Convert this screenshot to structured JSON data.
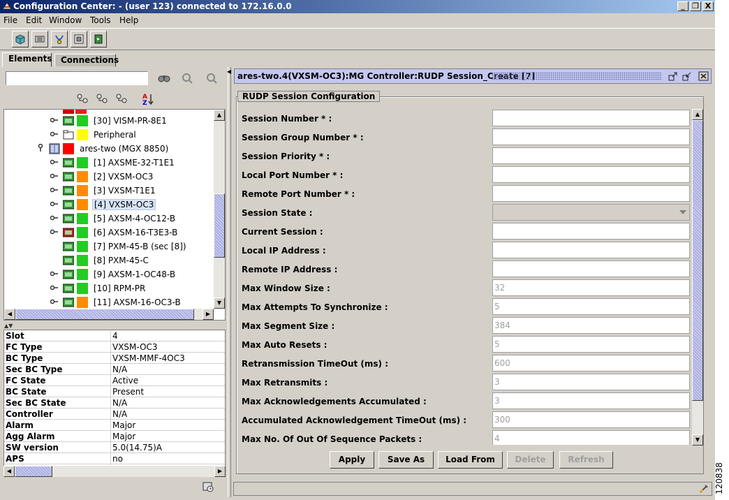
{
  "window": {
    "title": "Configuration Center: - (user 123) connected to 172.16.0.0",
    "buttons": [
      "_",
      "ͦ",
      "X"
    ]
  },
  "menu": [
    "File",
    "Edit",
    "Window",
    "Tools",
    "Help"
  ],
  "toolbar_icons": [
    "network-icon",
    "equipment-icon",
    "diagnostics-icon",
    "configure-icon",
    "export-icon"
  ],
  "tabs": {
    "elements": "Elements",
    "connections": "Connections"
  },
  "tree": {
    "search_value": "",
    "nodes": [
      {
        "label": "[30] VISM-PR-8E1",
        "status": "#22cc22"
      },
      {
        "label": "Peripheral",
        "status": "#ffff00"
      },
      {
        "label": "ares-two (MGX 8850)",
        "status": "#ff0000"
      },
      {
        "label": "[1] AXSME-32-T1E1",
        "status": "#22cc22"
      },
      {
        "label": "[2] VXSM-OC3",
        "status": "#ff8c00"
      },
      {
        "label": "[3] VXSM-T1E1",
        "status": "#ff8c00"
      },
      {
        "label": "[4] VXSM-OC3",
        "status": "#ff8c00"
      },
      {
        "label": "[5] AXSM-4-OC12-B",
        "status": "#22cc22"
      },
      {
        "label": "[6] AXSM-16-T3E3-B",
        "status": "#22cc22"
      },
      {
        "label": "[7] PXM-45-B (sec [8])",
        "status": "#22cc22"
      },
      {
        "label": "[8] PXM-45-C",
        "status": "#22cc22"
      },
      {
        "label": "[9] AXSM-1-OC48-B",
        "status": "#22cc22"
      },
      {
        "label": "[10] RPM-PR",
        "status": "#22cc22"
      },
      {
        "label": "[11] AXSM-16-OC3-B",
        "status": "#ff8c00"
      }
    ]
  },
  "properties": [
    {
      "key": "Slot",
      "value": "4"
    },
    {
      "key": "FC Type",
      "value": "VXSM-OC3"
    },
    {
      "key": "BC Type",
      "value": "VXSM-MMF-4OC3"
    },
    {
      "key": "Sec BC Type",
      "value": "N/A"
    },
    {
      "key": "FC State",
      "value": "Active"
    },
    {
      "key": "BC State",
      "value": "Present"
    },
    {
      "key": "Sec BC State",
      "value": "N/A"
    },
    {
      "key": "Controller",
      "value": "N/A"
    },
    {
      "key": "Alarm",
      "value": "Major"
    },
    {
      "key": "Agg Alarm",
      "value": "Major"
    },
    {
      "key": "SW version",
      "value": "5.0(14.75)A"
    },
    {
      "key": "APS",
      "value": "no"
    }
  ],
  "frame": {
    "title": "ares-two.4(VXSM-OC3):MG Controller:RUDP Session_Create [7]",
    "group_label": "RUDP Session Configuration",
    "fields": [
      {
        "label": "Session Number * :",
        "value": ""
      },
      {
        "label": "Session Group Number * :",
        "value": ""
      },
      {
        "label": "Session Priority * :",
        "value": ""
      },
      {
        "label": "Local Port Number * :",
        "value": ""
      },
      {
        "label": "Remote Port Number * :",
        "value": ""
      },
      {
        "label": "Session State :",
        "value": ""
      },
      {
        "label": "Current Session :",
        "value": ""
      },
      {
        "label": "Local IP Address :",
        "value": ""
      },
      {
        "label": "Remote IP Address :",
        "value": ""
      },
      {
        "label": "Max Window Size :",
        "value": "32"
      },
      {
        "label": "Max Attempts To Synchronize :",
        "value": "5"
      },
      {
        "label": "Max Segment Size :",
        "value": "384"
      },
      {
        "label": "Max Auto Resets :",
        "value": "5"
      },
      {
        "label": "Retransmission TimeOut (ms) :",
        "value": "600"
      },
      {
        "label": "Max Retransmits :",
        "value": "3"
      },
      {
        "label": "Max Acknowledgements Accumulated :",
        "value": "3"
      },
      {
        "label": "Accumulated Acknowledgement TimeOut (ms) :",
        "value": "300"
      },
      {
        "label": "Max No. Of Out Of Sequence Packets :",
        "value": "4"
      }
    ],
    "buttons": {
      "apply": "Apply",
      "save_as": "Save As",
      "load_from": "Load From",
      "delete": "Delete",
      "refresh": "Refresh"
    }
  },
  "figure_number": "120838"
}
